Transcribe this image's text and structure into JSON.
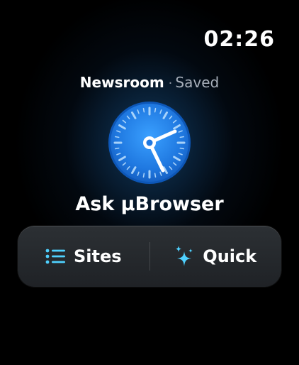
{
  "status_bar": {
    "time": "02:26"
  },
  "context": {
    "site": "Newsroom",
    "separator": "·",
    "status": "Saved"
  },
  "app": {
    "title": "Ask µBrowser",
    "icon": "compass-clock-icon"
  },
  "actions": [
    {
      "label": "Sites",
      "icon": "list-icon"
    },
    {
      "label": "Quick",
      "icon": "sparkles-icon"
    }
  ],
  "colors": {
    "accent": "#4fd1ff",
    "icon_blue": "#2f8ef0",
    "bar_background": "#24282c"
  }
}
